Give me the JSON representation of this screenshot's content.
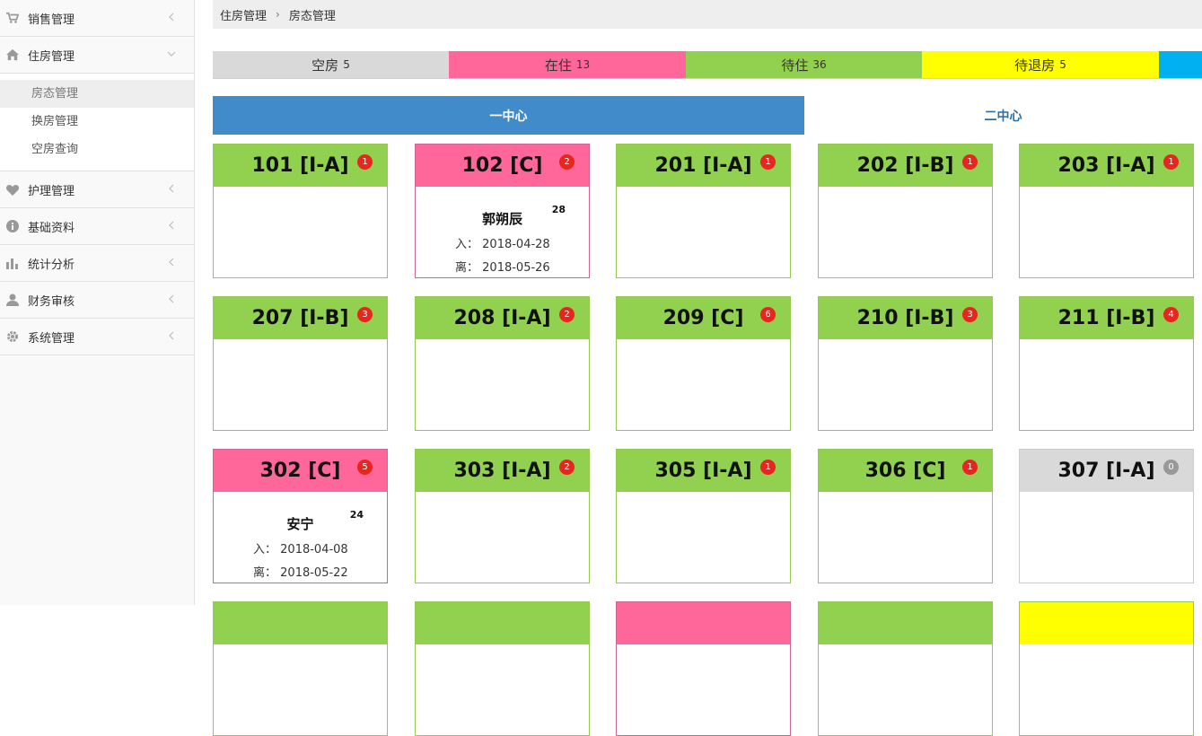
{
  "sidebar": {
    "items": [
      {
        "label": "销售管理",
        "icon": "cart-icon"
      },
      {
        "label": "住房管理",
        "icon": "home-icon"
      },
      {
        "label": "护理管理",
        "icon": "heart-icon"
      },
      {
        "label": "基础资料",
        "icon": "info-icon"
      },
      {
        "label": "统计分析",
        "icon": "bar-chart-icon"
      },
      {
        "label": "财务审核",
        "icon": "user-icon"
      },
      {
        "label": "系统管理",
        "icon": "gear-icon"
      }
    ],
    "submenu": [
      {
        "label": "房态管理",
        "active": true
      },
      {
        "label": "换房管理"
      },
      {
        "label": "空房查询"
      }
    ]
  },
  "breadcrumb": {
    "level1": "住房管理",
    "sep": "›",
    "level2": "房态管理"
  },
  "statuses": [
    {
      "label": "空房",
      "count": "5",
      "color": "#d9d9d9"
    },
    {
      "label": "在住",
      "count": "13",
      "color": "#ff6699"
    },
    {
      "label": "待住",
      "count": "36",
      "color": "#92d04f"
    },
    {
      "label": "待退房",
      "count": "5",
      "color": "#ffff00"
    }
  ],
  "centers": {
    "active": "一中心",
    "inactive": "二中心"
  },
  "labels": {
    "in": "入：",
    "out": "离："
  },
  "rooms": [
    {
      "title": "101 [I-A]",
      "badge": "1",
      "state": "g"
    },
    {
      "title": "102 [C]",
      "badge": "2",
      "state": "p",
      "guest": "郭朔辰",
      "days": "28",
      "in": "2018-04-28",
      "out": "2018-05-26"
    },
    {
      "title": "201 [I-A]",
      "badge": "1",
      "state": "g"
    },
    {
      "title": "202 [I-B]",
      "badge": "1",
      "state": "g"
    },
    {
      "title": "203 [I-A]",
      "badge": "1",
      "state": "g"
    },
    {
      "title": "207 [I-B]",
      "badge": "3",
      "state": "g"
    },
    {
      "title": "208 [I-A]",
      "badge": "2",
      "state": "g"
    },
    {
      "title": "209 [C]",
      "badge": "6",
      "state": "g"
    },
    {
      "title": "210 [I-B]",
      "badge": "3",
      "state": "g"
    },
    {
      "title": "211 [I-B]",
      "badge": "4",
      "state": "g"
    },
    {
      "title": "302 [C]",
      "badge": "5",
      "state": "p",
      "guest": "安宁",
      "days": "24",
      "in": "2018-04-08",
      "out": "2018-05-22"
    },
    {
      "title": "303 [I-A]",
      "badge": "2",
      "state": "g"
    },
    {
      "title": "305 [I-A]",
      "badge": "1",
      "state": "g"
    },
    {
      "title": "306 [C]",
      "badge": "1",
      "state": "g"
    },
    {
      "title": "307 [I-A]",
      "badge": "0",
      "state": "gr"
    },
    {
      "title": "",
      "badge": "",
      "state": "g"
    },
    {
      "title": "",
      "badge": "",
      "state": "g"
    },
    {
      "title": "",
      "badge": "",
      "state": "p"
    },
    {
      "title": "",
      "badge": "",
      "state": "g"
    },
    {
      "title": "",
      "badge": "",
      "state": "y"
    }
  ]
}
